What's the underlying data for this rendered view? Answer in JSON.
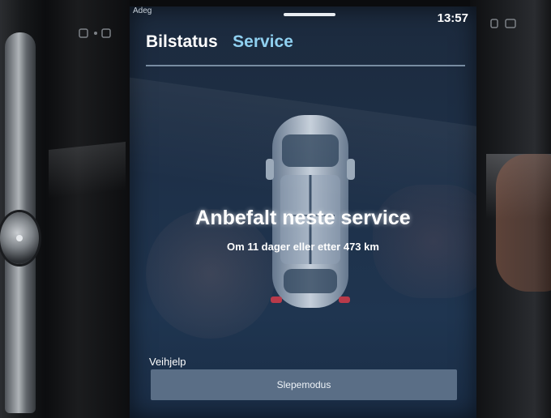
{
  "status_bar": {
    "left_text": "Adeg",
    "clock": "13:57"
  },
  "tabs": [
    {
      "label": "Bilstatus"
    },
    {
      "label": "Service"
    }
  ],
  "service": {
    "title": "Anbefalt neste service",
    "subtitle": "Om 11 dager eller etter 473 km"
  },
  "roadside": {
    "section_label": "Veihjelp",
    "tow_button_label": "Slepemodus"
  },
  "icons": {
    "car_illustration": "car-topview-icon",
    "left_trim_icon": "dashboard-indicator-icon",
    "right_trim_icon": "dashboard-indicator-icon"
  },
  "colors": {
    "screen_bg": "#1e3048",
    "active_tab": "#ffffff",
    "secondary_tab": "#8fd0f0",
    "button_bg": "#5a6e86"
  }
}
